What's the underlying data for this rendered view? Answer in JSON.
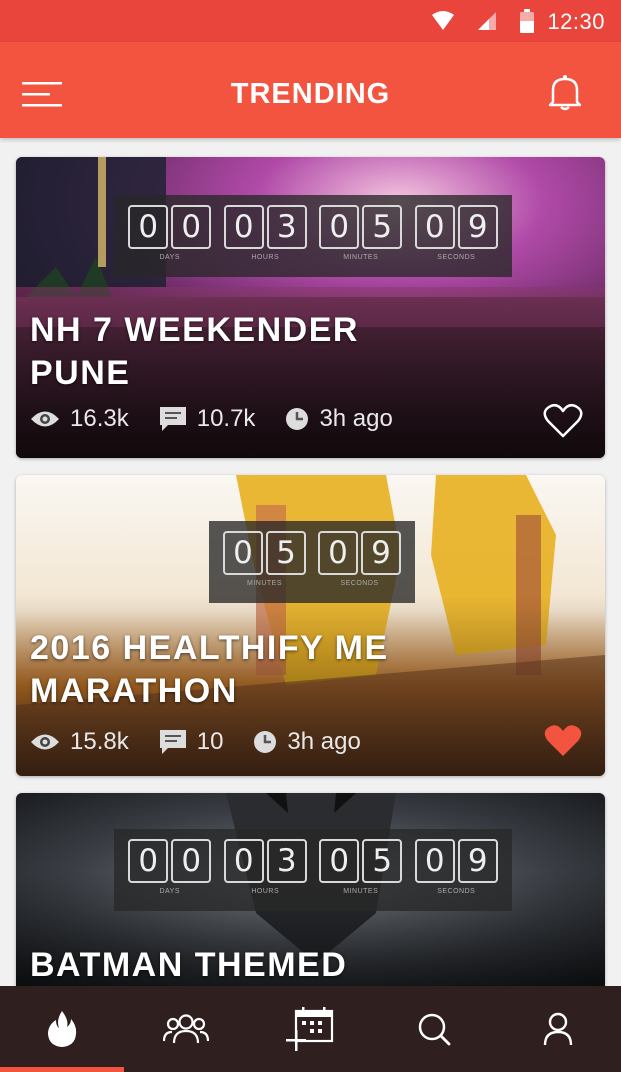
{
  "status_bar": {
    "time": "12:30"
  },
  "app_bar": {
    "title": "TRENDING",
    "icons": [
      "menu-icon",
      "bell-icon"
    ]
  },
  "cards": [
    {
      "title_line1": "NH 7 WEEKENDER",
      "title_line2": "PUNE",
      "countdown": {
        "days": [
          "0",
          "0"
        ],
        "hours": [
          "0",
          "3"
        ],
        "minutes": [
          "0",
          "5"
        ],
        "seconds": [
          "0",
          "9"
        ],
        "labels": {
          "days": "DAYS",
          "hours": "HOURS",
          "minutes": "MINUTES",
          "seconds": "SECONDS"
        }
      },
      "views": "16.3k",
      "comments": "10.7k",
      "time_ago": "3h ago",
      "liked": false
    },
    {
      "title_line1": "2016 HEALTHIFY ME",
      "title_line2": "MARATHON",
      "countdown": {
        "minutes": [
          "0",
          "5"
        ],
        "seconds": [
          "0",
          "9"
        ],
        "labels": {
          "minutes": "MINUTES",
          "seconds": "SECONDS"
        }
      },
      "views": "15.8k",
      "comments": "10",
      "time_ago": "3h ago",
      "liked": true
    },
    {
      "title_line1": "BATMAN THEMED",
      "countdown": {
        "days": [
          "0",
          "0"
        ],
        "hours": [
          "0",
          "3"
        ],
        "minutes": [
          "0",
          "5"
        ],
        "seconds": [
          "0",
          "9"
        ],
        "labels": {
          "days": "DAYS",
          "hours": "HOURS",
          "minutes": "MINUTES",
          "seconds": "SECONDS"
        }
      }
    }
  ],
  "bottom_nav": {
    "items": [
      "fire-icon",
      "community-icon",
      "add-event-icon",
      "search-icon",
      "profile-icon"
    ],
    "active": "fire-icon"
  },
  "colors": {
    "status_bar": "#e9453c",
    "app_bar": "#f3543f",
    "accent": "#f3543f",
    "nav_bg": "#2f1f1f",
    "heart_liked": "#f3543f"
  }
}
